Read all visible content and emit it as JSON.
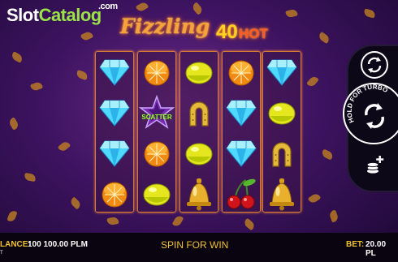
{
  "logo": {
    "text_a": "Slot",
    "text_b": "Catalog",
    "suffix": ".com"
  },
  "game": {
    "title_word": "Fizzling",
    "title_number": "40",
    "title_suffix": "HOT"
  },
  "reels": [
    [
      "diamond",
      "diamond",
      "diamond",
      "orange"
    ],
    [
      "orange",
      "scatter",
      "orange",
      "lemon"
    ],
    [
      "lemon",
      "horseshoe",
      "lemon",
      "bell"
    ],
    [
      "orange",
      "diamond",
      "diamond",
      "cherries"
    ],
    [
      "diamond",
      "lemon",
      "horseshoe",
      "bell"
    ]
  ],
  "scatter_label": "SCATTER",
  "controls": {
    "autoplay_icon": "autoplay-arrows-icon",
    "spin_icon": "spin-arrows-icon",
    "spin_ring_text": "HOLD FOR TURBO",
    "bet_icon": "coin-stack-plus-icon"
  },
  "bottom_bar": {
    "balance_label": "LANCE:",
    "balance_value": "100 100.00 PLM",
    "message": "SPIN FOR WIN",
    "bet_label": "BET:",
    "bet_value": "20.00 PL",
    "tiny_text": "T"
  },
  "colors": {
    "gold": "#f1c232",
    "reel_border": "#d27a34",
    "bg": "#3d1360",
    "logo_green": "#9be24a"
  }
}
